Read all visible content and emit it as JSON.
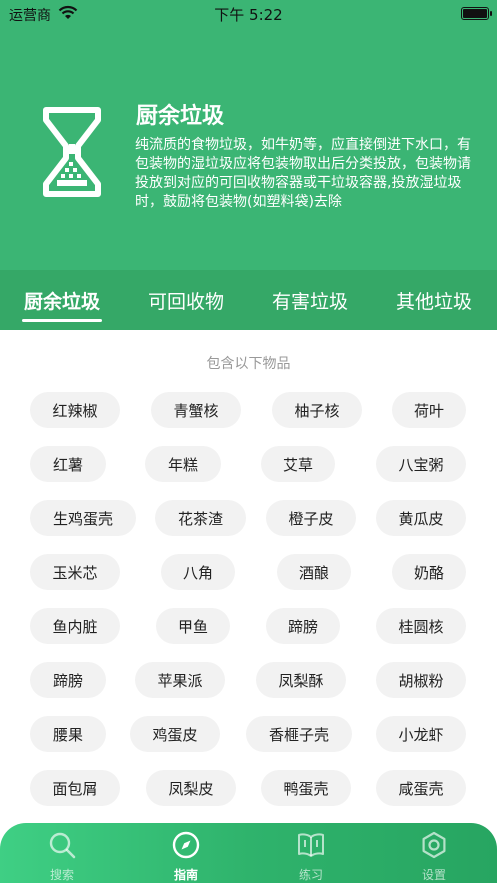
{
  "status_bar": {
    "carrier": "运营商",
    "time": "下午 5:22"
  },
  "header": {
    "title": "厨余垃圾",
    "description": "纯流质的食物垃圾，如牛奶等，应直接倒进下水口，有包装物的湿垃圾应将包装物取出后分类投放，包装物请投放到对应的可回收物容器或干垃圾容器,投放湿垃圾时，鼓励将包装物(如塑料袋)去除",
    "icon": "hourglass-icon"
  },
  "tabs": [
    {
      "label": "厨余垃圾",
      "active": true
    },
    {
      "label": "可回收物",
      "active": false
    },
    {
      "label": "有害垃圾",
      "active": false
    },
    {
      "label": "其他垃圾",
      "active": false
    }
  ],
  "section_title": "包含以下物品",
  "items": [
    "红辣椒",
    "青蟹核",
    "柚子核",
    "荷叶",
    "红薯",
    "年糕",
    "艾草",
    "八宝粥",
    "生鸡蛋壳",
    "花茶渣",
    "橙子皮",
    "黄瓜皮",
    "玉米芯",
    "八角",
    "酒酿",
    "奶酪",
    "鱼内脏",
    "甲鱼",
    "蹄膀",
    "桂圆核",
    "蹄膀",
    "苹果派",
    "凤梨酥",
    "胡椒粉",
    "腰果",
    "鸡蛋皮",
    "香榧子壳",
    "小龙虾",
    "面包屑",
    "凤梨皮",
    "鸭蛋壳",
    "咸蛋壳"
  ],
  "bottom_nav": [
    {
      "label": "搜索",
      "icon": "search-icon",
      "active": false
    },
    {
      "label": "指南",
      "icon": "compass-icon",
      "active": true
    },
    {
      "label": "练习",
      "icon": "book-icon",
      "active": false
    },
    {
      "label": "设置",
      "icon": "settings-icon",
      "active": false
    }
  ],
  "colors": {
    "primary": "#3bb574",
    "tab_bar": "#35a867",
    "chip_bg": "#f2f2f2"
  }
}
